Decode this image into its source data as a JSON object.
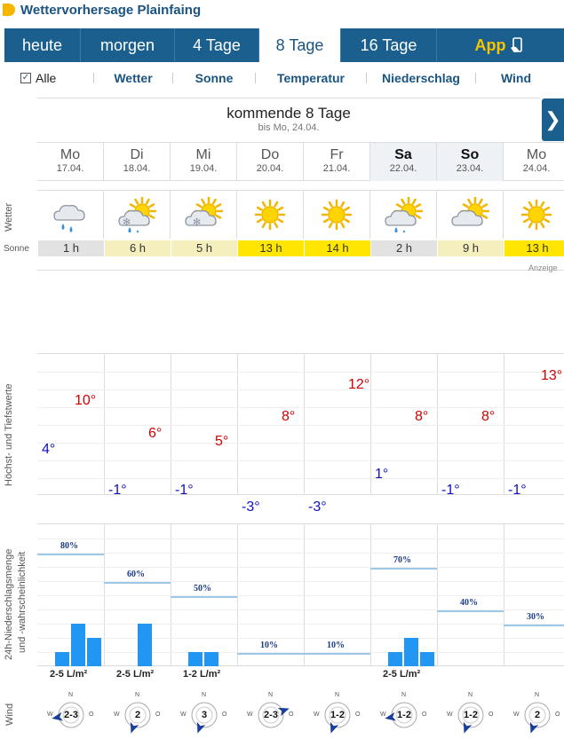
{
  "header": {
    "title": "Wettervorhersage Plainfaing"
  },
  "tabs": [
    {
      "label": "heute"
    },
    {
      "label": "morgen"
    },
    {
      "label": "4 Tage"
    },
    {
      "label": "8 Tage"
    },
    {
      "label": "16 Tage"
    },
    {
      "label": "App"
    }
  ],
  "filters": {
    "all": "Alle",
    "items": [
      "Wetter",
      "Sonne",
      "Temperatur",
      "Niederschlag",
      "Wind"
    ]
  },
  "period": {
    "heading": "kommende 8 Tage",
    "sub": "bis Mo, 24.04.",
    "next_symbol": "❯"
  },
  "days": [
    {
      "name": "Mo",
      "date": "17.04.",
      "weather": "rain-cloud",
      "sun": "1 h",
      "tmax": "10°",
      "tmin": "4°",
      "pop": "80%",
      "amount": "2-5 L/m²",
      "wind_dir": "W",
      "wind": "2-3"
    },
    {
      "name": "Di",
      "date": "18.04.",
      "weather": "sun-cloud-rain-snow",
      "sun": "6 h",
      "tmax": "6°",
      "tmin": "-1°",
      "pop": "60%",
      "amount": "2-5 L/m²",
      "wind_dir": "N",
      "wind": "2"
    },
    {
      "name": "Mi",
      "date": "19.04.",
      "weather": "sun-cloud-snow",
      "sun": "5 h",
      "tmax": "5°",
      "tmin": "-1°",
      "pop": "50%",
      "amount": "1-2 L/m²",
      "wind_dir": "N",
      "wind": "3"
    },
    {
      "name": "Do",
      "date": "20.04.",
      "weather": "sun",
      "sun": "13 h",
      "tmax": "8°",
      "tmin": "-3°",
      "pop": "10%",
      "amount": "",
      "wind_dir": "O",
      "wind": "2-3"
    },
    {
      "name": "Fr",
      "date": "21.04.",
      "weather": "sun",
      "sun": "14 h",
      "tmax": "12°",
      "tmin": "-3°",
      "pop": "10%",
      "amount": "",
      "wind_dir": "N",
      "wind": "1-2"
    },
    {
      "name": "Sa",
      "date": "22.04.",
      "weather": "sun-cloud-rain",
      "sun": "2 h",
      "tmax": "8°",
      "tmin": "1°",
      "pop": "70%",
      "amount": "2-5 L/m²",
      "wind_dir": "W",
      "wind": "1-2"
    },
    {
      "name": "So",
      "date": "23.04.",
      "weather": "sun-cloud",
      "sun": "9 h",
      "tmax": "8°",
      "tmin": "-1°",
      "pop": "40%",
      "amount": "",
      "wind_dir": "N",
      "wind": "1-2"
    },
    {
      "name": "Mo",
      "date": "24.04.",
      "weather": "sun",
      "sun": "13 h",
      "tmax": "13°",
      "tmin": "-1°",
      "pop": "30%",
      "amount": "",
      "wind_dir": "N",
      "wind": "2"
    }
  ],
  "labels": {
    "weather": "Wetter",
    "sun": "Sonne",
    "ad": "Anzeige",
    "temp": "Höchst- und Tiefstwerte",
    "precip1": "24h-Niederschlagsmenge",
    "precip2": "und -wahrscheinlichkeit",
    "wind": "Wind",
    "compass_n": "N",
    "compass_o": "O",
    "compass_w": "W"
  },
  "colors": {
    "brand": "#1a5f8e",
    "tmax": "#d00000",
    "tmin": "#1010c0",
    "precip_bar": "#2196f3",
    "sun_high": "#ffe600",
    "sun_mid": "#f5eebd",
    "sun_low": "#e2e2e2"
  },
  "chart_data": [
    {
      "type": "line",
      "x": [
        "17.04.",
        "18.04.",
        "19.04.",
        "20.04.",
        "21.04.",
        "22.04.",
        "23.04.",
        "24.04."
      ],
      "series": [
        {
          "values": [
            10,
            6,
            5,
            8,
            12,
            8,
            8,
            13
          ]
        },
        {
          "values": [
            4,
            -1,
            -1,
            -3,
            -3,
            1,
            -1,
            -1
          ]
        }
      ],
      "ylabel": "Höchst- und Tiefstwerte"
    },
    {
      "type": "bar",
      "x": [
        "17.04.",
        "18.04.",
        "19.04.",
        "20.04.",
        "21.04.",
        "22.04.",
        "23.04.",
        "24.04."
      ],
      "series": [
        {
          "values": [
            80,
            60,
            50,
            10,
            10,
            70,
            40,
            30
          ]
        }
      ],
      "sub_bars_relative_height": [
        [
          1,
          3,
          2
        ],
        [
          0,
          3,
          0
        ],
        [
          1,
          1,
          0
        ],
        [
          0,
          0,
          0
        ],
        [
          0,
          0,
          0
        ],
        [
          1,
          2,
          1
        ],
        [
          0,
          0,
          0
        ],
        [
          0,
          0,
          0
        ]
      ],
      "ylabel": "24h-Niederschlagsmenge und -wahrscheinlichkeit"
    }
  ]
}
